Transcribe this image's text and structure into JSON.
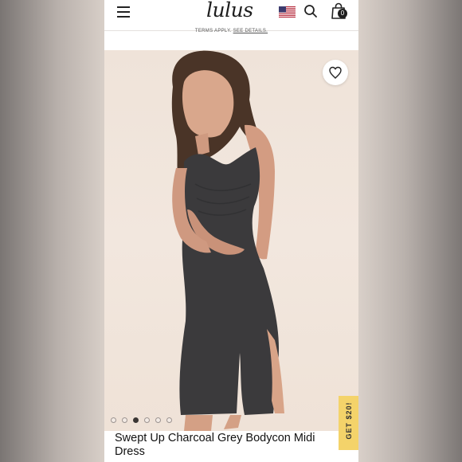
{
  "header": {
    "logo": "lulus",
    "cart_count": "0"
  },
  "notice": {
    "text": "TERMS APPLY.",
    "link": "SEE DETAILS."
  },
  "gallery": {
    "image_count": 6,
    "active_index": 2
  },
  "promo": {
    "label": "GET $20!"
  },
  "product": {
    "title": "Swept Up Charcoal Grey Bodycon Midi Dress"
  },
  "icons": {
    "menu": "hamburger-icon",
    "flag": "us-flag-icon",
    "search": "search-icon",
    "bag": "shopping-bag-icon",
    "favorite": "heart-icon"
  },
  "colors": {
    "hero_bg": "#f2e7de",
    "promo_tab": "#f4d36a",
    "dress": "#3b3a3c"
  }
}
